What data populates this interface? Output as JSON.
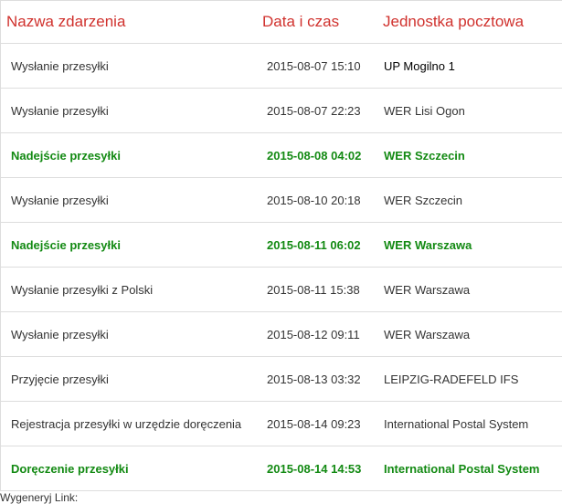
{
  "table": {
    "headers": {
      "event": "Nazwa zdarzenia",
      "datetime": "Data i czas",
      "office": "Jednostka pocztowa"
    },
    "rows": [
      {
        "event": "Wysłanie przesyłki",
        "datetime": "2015-08-07 15:10",
        "office": "UP Mogilno 1",
        "highlight": false
      },
      {
        "event": "Wysłanie przesyłki",
        "datetime": "2015-08-07 22:23",
        "office": "WER Lisi Ogon",
        "highlight": false
      },
      {
        "event": "Nadejście przesyłki",
        "datetime": "2015-08-08 04:02",
        "office": "WER Szczecin",
        "highlight": true
      },
      {
        "event": "Wysłanie przesyłki",
        "datetime": "2015-08-10 20:18",
        "office": "WER Szczecin",
        "highlight": false
      },
      {
        "event": "Nadejście przesyłki",
        "datetime": "2015-08-11 06:02",
        "office": "WER Warszawa",
        "highlight": true
      },
      {
        "event": "Wysłanie przesyłki z Polski",
        "datetime": "2015-08-11 15:38",
        "office": "WER Warszawa",
        "highlight": false
      },
      {
        "event": "Wysłanie przesyłki",
        "datetime": "2015-08-12 09:11",
        "office": "WER Warszawa",
        "highlight": false
      },
      {
        "event": "Przyjęcie przesyłki",
        "datetime": "2015-08-13 03:32",
        "office": "LEIPZIG-RADEFELD IFS",
        "highlight": false
      },
      {
        "event": "Rejestracja przesyłki w urzędzie doręczenia",
        "datetime": "2015-08-14 09:23",
        "office": "International Postal System",
        "highlight": false
      },
      {
        "event": "Doręczenie przesyłki",
        "datetime": "2015-08-14 14:53",
        "office": "International Postal System",
        "highlight": true
      }
    ]
  },
  "footer": {
    "label": "Wygenerуj Link:"
  },
  "colors": {
    "header_text": "#d0312d",
    "highlight_text": "#138a13",
    "body_text": "#333333",
    "border": "#dddddd"
  }
}
